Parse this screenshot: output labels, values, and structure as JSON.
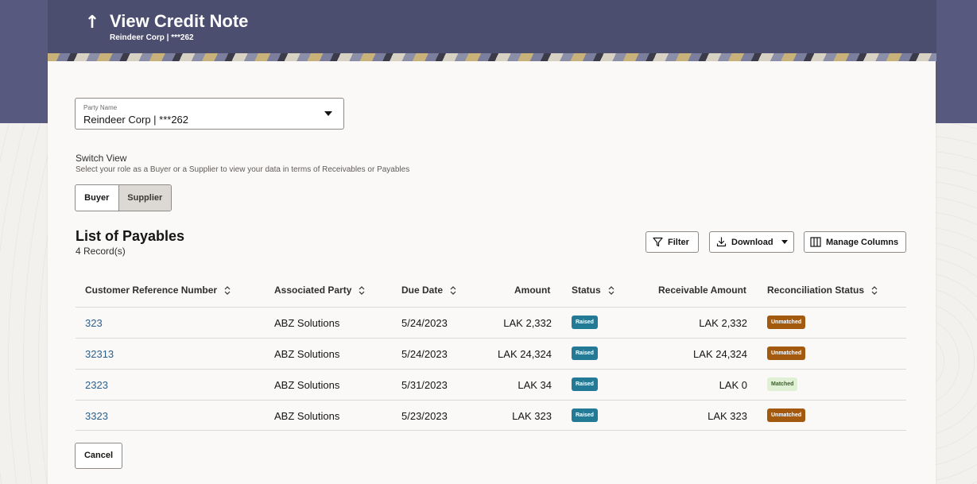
{
  "header": {
    "title": "View Credit Note",
    "subtitle": "Reindeer Corp | ***262",
    "back_icon": "up-arrow-icon",
    "band_color": "#575a7e"
  },
  "party": {
    "label": "Party Name",
    "value": "Reindeer Corp | ***262"
  },
  "switch_view": {
    "title": "Switch View",
    "description": "Select your role as a Buyer or a Supplier to view your data in terms of Receivables or Payables",
    "options": [
      "Buyer",
      "Supplier"
    ],
    "selected": "Supplier"
  },
  "list": {
    "title": "List of Payables",
    "record_count": "4 Record(s)"
  },
  "toolbar": {
    "filter_label": "Filter",
    "download_label": "Download",
    "manage_columns_label": "Manage Columns"
  },
  "table": {
    "columns": [
      "Customer Reference Number",
      "Associated Party",
      "Due Date",
      "Amount",
      "Status",
      "Receivable Amount",
      "Reconciliation Status"
    ],
    "rows": [
      {
        "ref": "323",
        "party": "ABZ Solutions",
        "due": "5/24/2023",
        "amount": "LAK 2,332",
        "status": "Raised",
        "receivable": "LAK 2,332",
        "recon": "Unmatched"
      },
      {
        "ref": "32313",
        "party": "ABZ Solutions",
        "due": "5/24/2023",
        "amount": "LAK 24,324",
        "status": "Raised",
        "receivable": "LAK 24,324",
        "recon": "Unmatched"
      },
      {
        "ref": "2323",
        "party": "ABZ Solutions",
        "due": "5/31/2023",
        "amount": "LAK 34",
        "status": "Raised",
        "receivable": "LAK 0",
        "recon": "Matched"
      },
      {
        "ref": "3323",
        "party": "ABZ Solutions",
        "due": "5/23/2023",
        "amount": "LAK 323",
        "status": "Raised",
        "receivable": "LAK 323",
        "recon": "Unmatched"
      }
    ]
  },
  "actions": {
    "cancel_label": "Cancel"
  },
  "colors": {
    "raised": "#227a96",
    "unmatched": "#a35a0f",
    "matched_bg": "#dff0d4",
    "link": "#2c5f8a"
  }
}
